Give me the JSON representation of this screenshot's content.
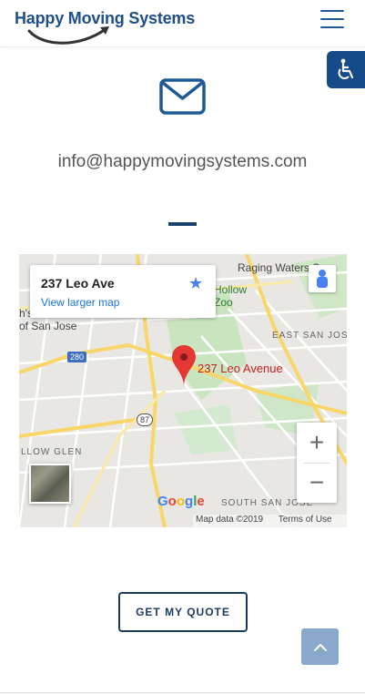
{
  "header": {
    "logo_text": "Happy Moving Systems",
    "menu_icon": "hamburger-menu-icon"
  },
  "accessibility": {
    "icon": "wheelchair-icon"
  },
  "contact": {
    "icon": "envelope-icon",
    "email": "info@happymovingsystems.com"
  },
  "map": {
    "card": {
      "address": "237 Leo Ave",
      "larger_map_link": "View larger map"
    },
    "pin_label": "237 Leo Avenue",
    "labels": {
      "raging_waters": "Raging Waters S",
      "hollow": "Hollow",
      "zoo": "Zoo",
      "san_jose_partial": "of San Jose",
      "partial_h": "h's",
      "east_san_jose": "EAST SAN JOSE",
      "willow_glen": "LLOW GLEN",
      "south_san_jose": "SOUTH SAN JOSE",
      "hwy_280": "280",
      "hwy_87": "87"
    },
    "zoom_in": "+",
    "zoom_out": "−",
    "google_logo": "Google",
    "attribution": {
      "data": "Map data ©2019",
      "terms": "Terms of Use"
    }
  },
  "cta": {
    "quote_label": "GET MY QUOTE"
  },
  "scroll_top_icon": "chevron-up-icon",
  "colors": {
    "brand": "#1f4f86",
    "accessibility_bg": "#164b8a",
    "divider": "#1b4370",
    "scroll_top_bg": "#8aa8cc"
  }
}
